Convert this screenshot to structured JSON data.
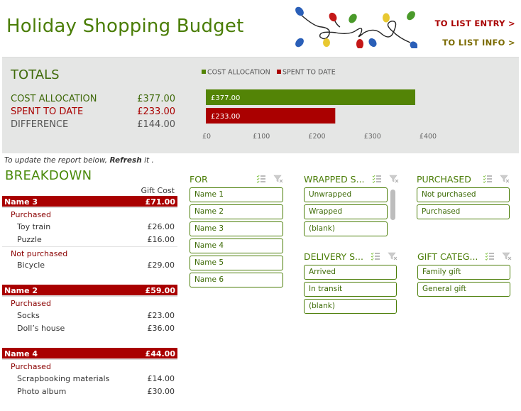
{
  "header": {
    "title": "Holiday Shopping Budget",
    "nav_links": [
      {
        "label": "TO LIST ENTRY >"
      },
      {
        "label": "TO LIST INFO >"
      }
    ]
  },
  "totals": {
    "title": "TOTALS",
    "rows": [
      {
        "label": "COST ALLOCATION",
        "value": "£377.00"
      },
      {
        "label": "SPENT TO DATE",
        "value": "£233.00"
      },
      {
        "label": "DIFFERENCE",
        "value": "£144.00"
      }
    ]
  },
  "colors": {
    "green": "#4a7d06",
    "red": "#a90000",
    "panel_gray": "#e5e6e5"
  },
  "chart_data": {
    "type": "bar",
    "orientation": "horizontal",
    "title": "",
    "categories": [
      "COST ALLOCATION",
      "SPENT TO DATE"
    ],
    "series": [
      {
        "name": "COST ALLOCATION",
        "values": [
          377
        ],
        "color": "#538406",
        "data_label": "£377.00"
      },
      {
        "name": "SPENT TO DATE",
        "values": [
          233
        ],
        "color": "#aa0000",
        "data_label": "£233.00"
      }
    ],
    "legend": [
      "COST ALLOCATION",
      "SPENT TO DATE"
    ],
    "legend_position": "top-left",
    "xlim": [
      0,
      400
    ],
    "xticks": [
      "£0",
      "£100",
      "£200",
      "£300",
      "£400"
    ],
    "grid": false,
    "xlabel": "",
    "ylabel": ""
  },
  "report": {
    "note_prefix": "To update the report below, ",
    "note_bold": "Refresh",
    "note_suffix": " it .",
    "breakdown_title": "BREAKDOWN",
    "column_header": "Gift Cost",
    "groups": [
      {
        "name": "Name 3",
        "total": "£71.00",
        "statuses": [
          {
            "status": "Purchased",
            "items": [
              {
                "item": "Toy train",
                "cost": "£26.00"
              },
              {
                "item": "Puzzle",
                "cost": "£16.00"
              }
            ]
          },
          {
            "status": "Not purchased",
            "items": [
              {
                "item": "Bicycle",
                "cost": "£29.00"
              }
            ]
          }
        ]
      },
      {
        "name": "Name 2",
        "total": "£59.00",
        "statuses": [
          {
            "status": "Purchased",
            "items": [
              {
                "item": "Socks",
                "cost": "£23.00"
              },
              {
                "item": "Doll’s house",
                "cost": "£36.00"
              }
            ]
          }
        ]
      },
      {
        "name": "Name 4",
        "total": "£44.00",
        "statuses": [
          {
            "status": "Purchased",
            "items": [
              {
                "item": "Scrapbooking materials",
                "cost": "£14.00"
              },
              {
                "item": "Photo album",
                "cost": "£30.00"
              }
            ]
          }
        ]
      }
    ]
  },
  "slicers": {
    "for": {
      "title": "FOR",
      "items": [
        "Name 1",
        "Name 2",
        "Name 3",
        "Name 4",
        "Name 5",
        "Name 6"
      ]
    },
    "wrapped": {
      "title": "WRAPPED S...",
      "items": [
        "Unwrapped",
        "Wrapped",
        "(blank)"
      ]
    },
    "purchased": {
      "title": "PURCHASED",
      "items": [
        "Not purchased",
        "Purchased"
      ]
    },
    "delivery": {
      "title": "DELIVERY S...",
      "items": [
        "Arrived",
        "In transit",
        "(blank)"
      ]
    },
    "gift_category": {
      "title": "GIFT CATEG...",
      "items": [
        "Family gift",
        "General gift"
      ]
    }
  }
}
